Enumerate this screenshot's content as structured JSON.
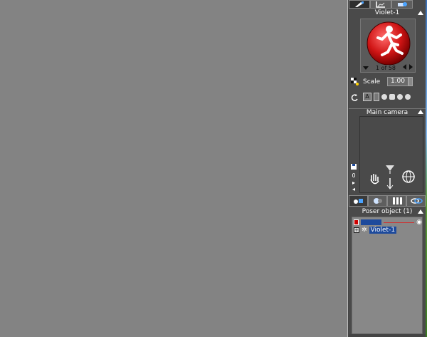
{
  "library": {
    "figure_name": "Violet-1",
    "page_counter": "1 of 58",
    "scale_label": "Scale",
    "scale_value": "1.00",
    "layer_box": "A"
  },
  "camera": {
    "title": "Main camera",
    "side_value": "0"
  },
  "scene": {
    "header": "Poser object (1)",
    "item_label": "Violet-1"
  },
  "colors": {
    "viewport": "#838383",
    "panel": "#4a4a4a",
    "selection": "#1d4a9c",
    "preview_red": "#cc1111"
  }
}
